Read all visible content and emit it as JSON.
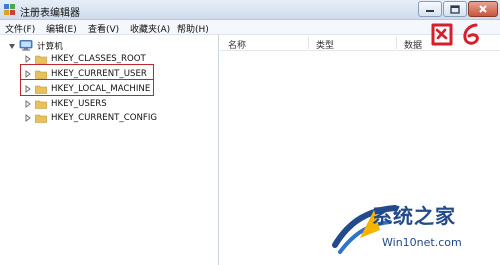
{
  "window": {
    "title": "注册表编辑器"
  },
  "menu": {
    "items": [
      "文件(F)",
      "编辑(E)",
      "查看(V)",
      "收藏夹(A)",
      "帮助(H)"
    ]
  },
  "tree": {
    "root": "计算机",
    "keys": [
      "HKEY_CLASSES_ROOT",
      "HKEY_CURRENT_USER",
      "HKEY_LOCAL_MACHINE",
      "HKEY_USERS",
      "HKEY_CURRENT_CONFIG"
    ]
  },
  "list": {
    "columns": [
      "名称",
      "类型",
      "数据"
    ]
  },
  "annotation": {
    "text": "图 6",
    "color": "#d61f2a"
  },
  "watermark": {
    "brand": "系统之家",
    "site": "Win10net.com",
    "color": "#234a8a"
  },
  "colors": {
    "highlight": "#c0282f",
    "folder": "#e8c15a"
  }
}
